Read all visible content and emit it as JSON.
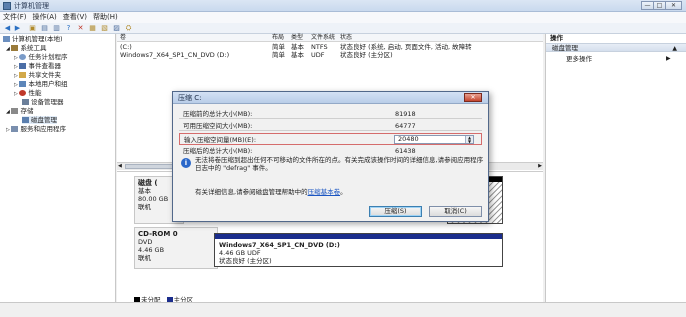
{
  "window": {
    "title": "计算机管理",
    "buttons": {
      "minimize": "—",
      "maximize": "□",
      "close": "✕"
    }
  },
  "menu": [
    "文件(F)",
    "操作(A)",
    "查看(V)",
    "帮助(H)"
  ],
  "tree": {
    "root": "计算机管理(本地)",
    "system_tools": "系统工具",
    "task_scheduler": "任务计划程序",
    "event_viewer": "事件查看器",
    "shared_folders": "共享文件夹",
    "users_groups": "本地用户和组",
    "performance": "性能",
    "device_manager": "设备管理器",
    "storage": "存储",
    "disk_management": "磁盘管理",
    "services_apps": "服务和应用程序"
  },
  "volume_table": {
    "headers": [
      "卷",
      "布局",
      "类型",
      "文件系统",
      "状态"
    ],
    "rows": [
      [
        "(C:)",
        "简单",
        "基本",
        "NTFS",
        "状态良好 (系统, 启动, 页面文件, 活动, 故障转"
      ],
      [
        "Windows7_X64_SP1_CN_DVD (D:)",
        "简单",
        "基本",
        "UDF",
        "状态良好 (主分区)"
      ]
    ]
  },
  "disks": {
    "disk0": {
      "label": "磁盘 0",
      "label_visible": "磁盘 (",
      "type": "基本",
      "size": "80.00 GB",
      "status": "联机"
    },
    "cdrom": {
      "label": "CD-ROM 0",
      "type": "DVD",
      "size": "4.46 GB",
      "status": "联机",
      "volume_name": "Windows7_X64_SP1_CN_DVD (D:)",
      "volume_size": "4.46 GB UDF",
      "volume_status": "状态良好 (主分区)"
    }
  },
  "legend": {
    "unallocated": "未分配",
    "primary": "主分区",
    "unallocated_color": "#000000",
    "primary_color": "#1b2d8c"
  },
  "actions": {
    "header": "操作",
    "section": "磁盘管理",
    "more": "更多操作"
  },
  "dialog": {
    "title": "压缩 C:",
    "rows": [
      {
        "label": "压缩前的总计大小(MB):",
        "value": "81918"
      },
      {
        "label": "可用压缩空间大小(MB):",
        "value": "64777"
      },
      {
        "label": "输入压缩空间量(MB)(E):",
        "value": "20480"
      },
      {
        "label": "压缩后的总计大小(MB):",
        "value": "61438"
      }
    ],
    "info": "无法将卷压缩到超出任何不可移动的文件所在的点。有关完成该操作时间的详细信息,请参阅应用程序日志中的 \"defrag\" 事件。",
    "help_prefix": "有关详细信息,请参阅磁盘管理帮助中的",
    "help_link": "压缩基本卷",
    "help_suffix": "。",
    "compress_button": "压缩(S)",
    "cancel_button": "取消(C)"
  }
}
